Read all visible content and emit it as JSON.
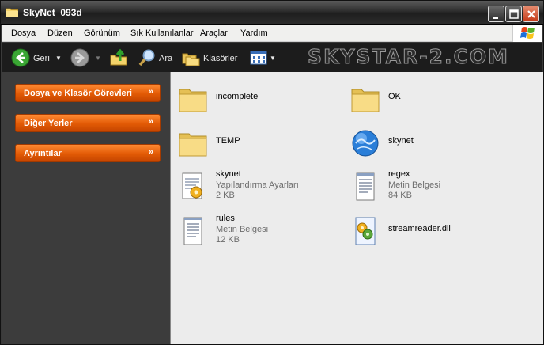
{
  "window": {
    "title": "SkyNet_093d"
  },
  "menu": [
    "Dosya",
    "Düzen",
    "Görünüm",
    "Sık Kullanılanlar",
    "Araçlar",
    "Yardım"
  ],
  "toolbar": {
    "back_label": "Geri",
    "search_label": "Ara",
    "folders_label": "Klasörler",
    "watermark": "SKYSTAR-2.COM"
  },
  "left_panels": [
    {
      "label": "Dosya ve Klasör Görevleri",
      "chevron": "»"
    },
    {
      "label": "Diğer Yerler",
      "chevron": "»"
    },
    {
      "label": "Ayrıntılar",
      "chevron": "»"
    }
  ],
  "items": [
    {
      "name": "incomplete",
      "type": "",
      "size": "",
      "icon": "folder-icon"
    },
    {
      "name": "OK",
      "type": "",
      "size": "",
      "icon": "folder-icon"
    },
    {
      "name": "TEMP",
      "type": "",
      "size": "",
      "icon": "folder-icon"
    },
    {
      "name": "skynet",
      "type": "",
      "size": "",
      "icon": "globe-executable-icon"
    },
    {
      "name": "skynet",
      "type": "Yapılandırma Ayarları",
      "size": "2 KB",
      "icon": "config-file-icon"
    },
    {
      "name": "regex",
      "type": "Metin Belgesi",
      "size": "84 KB",
      "icon": "text-file-icon"
    },
    {
      "name": "rules",
      "type": "Metin Belgesi",
      "size": "12 KB",
      "icon": "text-file-icon"
    },
    {
      "name": "streamreader.dll",
      "type": "",
      "size": "",
      "icon": "dll-file-icon"
    }
  ],
  "colors": {
    "accent_orange": "#e25a05",
    "title_bar": "#2e2e2e",
    "content_bg": "#ececec",
    "left_pane_bg": "#3c3c3c"
  }
}
